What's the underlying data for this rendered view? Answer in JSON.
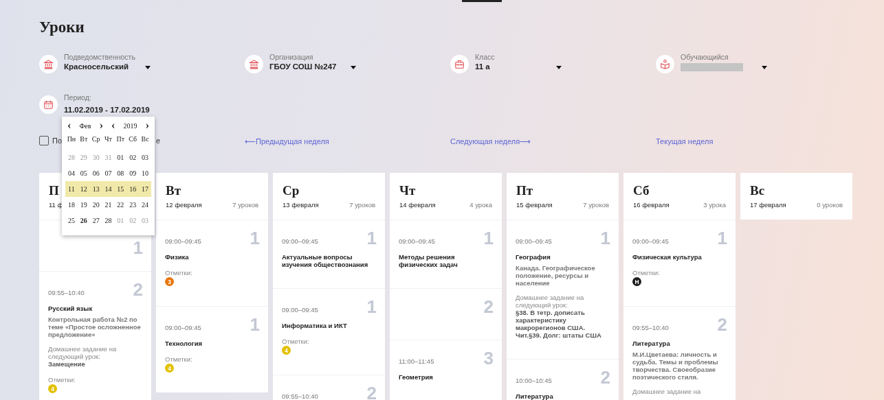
{
  "title": "Уроки",
  "filters": [
    {
      "label": "Подведомственность",
      "value": "Красносельский",
      "kind": "institution"
    },
    {
      "label": "Организация",
      "value": "ГБОУ СОШ №247",
      "kind": "institution"
    },
    {
      "label": "Класс",
      "value": "11 а",
      "kind": "briefcase"
    },
    {
      "label": "Обучающийся",
      "redacted": true,
      "kind": "reader"
    }
  ],
  "period": {
    "label": "Период:",
    "value": "11.02.2019 - 17.02.2019"
  },
  "checkbox": {
    "checked": false,
    "label_start": "По",
    "label_end": "е"
  },
  "week_links": [
    {
      "text": "⟵Предыдущая неделя"
    },
    {
      "text": "Следующая неделя⟶"
    },
    {
      "text": "Текущая неделя"
    }
  ],
  "calendar": {
    "prev": "‹",
    "month": "Фев",
    "next": "›",
    "year": "2019",
    "weekdays": [
      "Пн",
      "Вт",
      "Ср",
      "Чт",
      "Пт",
      "Сб",
      "Вс"
    ],
    "weeks": [
      {
        "selected": false,
        "days": [
          {
            "label": "28",
            "outside": true,
            "today": false
          },
          {
            "label": "29",
            "outside": true,
            "today": false
          },
          {
            "label": "30",
            "outside": true,
            "today": false
          },
          {
            "label": "31",
            "outside": true,
            "today": false
          },
          {
            "label": "01",
            "outside": false,
            "today": false
          },
          {
            "label": "02",
            "outside": false,
            "today": false
          },
          {
            "label": "03",
            "outside": false,
            "today": false
          }
        ]
      },
      {
        "selected": false,
        "days": [
          {
            "label": "04",
            "outside": false,
            "today": false
          },
          {
            "label": "05",
            "outside": false,
            "today": false
          },
          {
            "label": "06",
            "outside": false,
            "today": false
          },
          {
            "label": "07",
            "outside": false,
            "today": false
          },
          {
            "label": "08",
            "outside": false,
            "today": false
          },
          {
            "label": "09",
            "outside": false,
            "today": false
          },
          {
            "label": "10",
            "outside": false,
            "today": false
          }
        ]
      },
      {
        "selected": true,
        "days": [
          {
            "label": "11",
            "outside": false,
            "today": false
          },
          {
            "label": "12",
            "outside": false,
            "today": false
          },
          {
            "label": "13",
            "outside": false,
            "today": false
          },
          {
            "label": "14",
            "outside": false,
            "today": false
          },
          {
            "label": "15",
            "outside": false,
            "today": false
          },
          {
            "label": "16",
            "outside": false,
            "today": false
          },
          {
            "label": "17",
            "outside": false,
            "today": false
          }
        ]
      },
      {
        "selected": false,
        "days": [
          {
            "label": "18",
            "outside": false,
            "today": false
          },
          {
            "label": "19",
            "outside": false,
            "today": false
          },
          {
            "label": "20",
            "outside": false,
            "today": false
          },
          {
            "label": "21",
            "outside": false,
            "today": false
          },
          {
            "label": "22",
            "outside": false,
            "today": false
          },
          {
            "label": "23",
            "outside": false,
            "today": false
          },
          {
            "label": "24",
            "outside": false,
            "today": false
          }
        ]
      },
      {
        "selected": false,
        "days": [
          {
            "label": "25",
            "outside": false,
            "today": false
          },
          {
            "label": "26",
            "outside": false,
            "today": true
          },
          {
            "label": "27",
            "outside": false,
            "today": false
          },
          {
            "label": "28",
            "outside": false,
            "today": false
          },
          {
            "label": "01",
            "outside": true,
            "today": false
          },
          {
            "label": "02",
            "outside": true,
            "today": false
          },
          {
            "label": "03",
            "outside": true,
            "today": false
          }
        ]
      }
    ]
  },
  "days": [
    {
      "name": "П",
      "date": "11 ф",
      "lessons": [
        {
          "number": "1"
        },
        {
          "number": "2",
          "time": "09:55–10:40",
          "subject": "Русский язык",
          "topic": "Контрольная работа №2 по теме «Простое осложненное предложение»",
          "homework_label": "Домашнее задание на следующий урок:",
          "homework": "Замещение",
          "marks_label": "Отметки:",
          "marks": [
            {
              "value": "4",
              "color": "#e3c000"
            }
          ]
        }
      ]
    },
    {
      "name": "Вт",
      "date": "12 февраля",
      "count": "7 уроков",
      "lessons": [
        {
          "number": "1",
          "time": "09:00–09:45",
          "subject": "Физика",
          "marks_label": "Отметки:",
          "marks": [
            {
              "value": "3",
              "color": "#e8750c"
            }
          ]
        },
        {
          "number": "1",
          "time": "09:00–09:45",
          "subject": "Технология",
          "marks_label": "Отметки:",
          "marks": [
            {
              "value": "4",
              "color": "#e3c000"
            }
          ]
        }
      ]
    },
    {
      "name": "Ср",
      "date": "13 февраля",
      "count": "7 уроков",
      "lessons": [
        {
          "number": "1",
          "time": "09:00–09:45",
          "subject": "Актуальные вопросы изучения обществознания"
        },
        {
          "number": "1",
          "time": "09:00–09:45",
          "subject": "Информатика и ИКТ",
          "marks_label": "Отметки:",
          "marks": [
            {
              "value": "4",
              "color": "#e3c000"
            }
          ]
        },
        {
          "number": "2",
          "time": "09:55–10:40"
        }
      ]
    },
    {
      "name": "Чт",
      "date": "14 февраля",
      "count": "4 урока",
      "lessons": [
        {
          "number": "1",
          "time": "09:00–09:45",
          "subject": "Методы решения физических задач"
        },
        {
          "number": "2"
        },
        {
          "number": "3",
          "time": "11:00–11:45",
          "subject": "Геометрия"
        }
      ]
    },
    {
      "name": "Пт",
      "date": "15 февраля",
      "count": "7 уроков",
      "lessons": [
        {
          "number": "1",
          "time": "09:00–09:45",
          "subject": "География",
          "topic": "Канада. Географическое положение, ресурсы и население",
          "homework_label": "Домашнее задание на следующий урок:",
          "homework": "§38. В тетр. дописать характеристику макрорегионов США. Чит.§39. Долг: штаты США"
        },
        {
          "number": "2",
          "time": "10:00–10:45",
          "subject": "Литература"
        }
      ]
    },
    {
      "name": "Сб",
      "date": "16 февраля",
      "count": "3 урока",
      "lessons": [
        {
          "number": "1",
          "time": "09:00–09:45",
          "subject": "Физическая культура",
          "marks_label": "Отметки:",
          "marks": [
            {
              "value": "Н",
              "color": "#1e1e1e"
            }
          ]
        },
        {
          "number": "2",
          "time": "09:55–10:40",
          "subject": "Литература",
          "topic": "М.И.Цветаева: личность и судьба. Темы и проблемы творчества. Своеобразие поэтического стиля.",
          "homework_label": "Домашнее задание на"
        }
      ]
    },
    {
      "name": "Вс",
      "date": "17 февраля",
      "count": "0 уроков"
    }
  ]
}
